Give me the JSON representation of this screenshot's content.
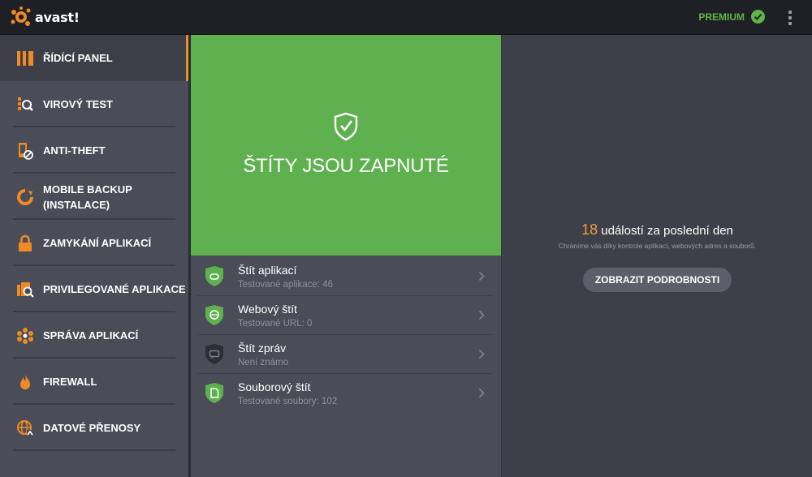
{
  "app": {
    "logo_text": "avast!"
  },
  "topbar": {
    "premium_label": "PREMIUM"
  },
  "sidebar": {
    "items": [
      {
        "label": "ŘÍDÍCÍ PANEL",
        "icon": "dashboard-icon",
        "active": true
      },
      {
        "label": "VIROVÝ TEST",
        "icon": "scan-icon"
      },
      {
        "label": "ANTI-THEFT",
        "icon": "anti-theft-icon"
      },
      {
        "label_line1": "MOBILE BACKUP",
        "label_line2": "(INSTALACE)",
        "icon": "backup-icon"
      },
      {
        "label": "ZAMYKÁNÍ APLIKACÍ",
        "icon": "lock-icon"
      },
      {
        "label": "PRIVILEGOVANÉ APLIKACE",
        "icon": "privileged-apps-icon"
      },
      {
        "label": "SPRÁVA APLIKACÍ",
        "icon": "app-manager-icon"
      },
      {
        "label": "FIREWALL",
        "icon": "firewall-icon"
      },
      {
        "label": "DATOVÉ PŘENOSY",
        "icon": "data-transfer-icon"
      }
    ]
  },
  "hero": {
    "title": "ŠTÍTY JSOU ZAPNUTÉ"
  },
  "shields": [
    {
      "name": "Štít aplikací",
      "status": "Testované aplikace: 46",
      "color": "#5fb14f"
    },
    {
      "name": "Webový štít",
      "status": "Testované URL: 0",
      "color": "#5fb14f"
    },
    {
      "name": "Štít zpráv",
      "status": "Není známo",
      "color": "#2c2e35"
    },
    {
      "name": "Souborový štít",
      "status": "Testované soubory: 102",
      "color": "#5fb14f"
    }
  ],
  "panel": {
    "events_count": "18",
    "events_text": "událostí za poslední den",
    "subtitle": "Chráníme vás díky kontrole aplikací, webových adres a souborů.",
    "details_button": "ZOBRAZIT PODROBNOSTI"
  },
  "colors": {
    "accent": "#f08a24",
    "green": "#5fb14f",
    "premium": "#5fb546",
    "events_number": "#f29a3e"
  }
}
